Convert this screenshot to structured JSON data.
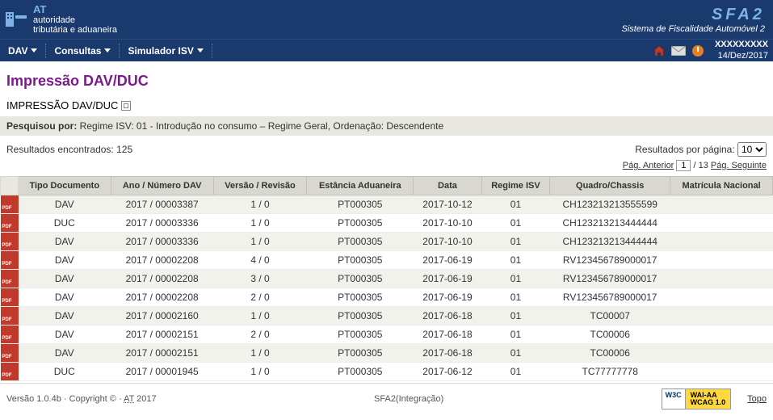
{
  "header": {
    "org_code": "AT",
    "org_line1": "autoridade",
    "org_line2": "tributária e aduaneira",
    "app_code": "SFA2",
    "app_name": "Sistema de Fiscalidade Automóvel 2"
  },
  "menu": {
    "items": [
      "DAV",
      "Consultas",
      "Simulador ISV"
    ],
    "user": "XXXXXXXXX",
    "date": "14/Dez/2017"
  },
  "page": {
    "title": "Impressão DAV/DUC",
    "section": "IMPRESSÃO DAV/DUC",
    "search_label": "Pesquisou por:",
    "search_text": " Regime ISV: 01 - Introdução no consumo – Regime Geral, Ordenação: Descendente",
    "results_count_label": "Resultados encontrados: ",
    "results_count": "125",
    "results_per_page_label": "Resultados por página: ",
    "results_per_page_value": "10",
    "pag_prev": "Pág. Anterior",
    "pag_current": "1",
    "pag_total": "/ 13 ",
    "pag_next": "Pág. Seguinte"
  },
  "columns": [
    "Tipo Documento",
    "Ano / Número DAV",
    "Versão / Revisão",
    "Estância Aduaneira",
    "Data",
    "Regime ISV",
    "Quadro/Chassis",
    "Matrícula Nacional"
  ],
  "rows": [
    {
      "tipo": "DAV",
      "ano": "2017 / 00003387",
      "ver": "1 / 0",
      "est": "PT000305",
      "data": "2017-10-12",
      "reg": "01",
      "chassis": "CH123213213555599",
      "mat": ""
    },
    {
      "tipo": "DUC",
      "ano": "2017 / 00003336",
      "ver": "1 / 0",
      "est": "PT000305",
      "data": "2017-10-10",
      "reg": "01",
      "chassis": "CH123213213444444",
      "mat": ""
    },
    {
      "tipo": "DAV",
      "ano": "2017 / 00003336",
      "ver": "1 / 0",
      "est": "PT000305",
      "data": "2017-10-10",
      "reg": "01",
      "chassis": "CH123213213444444",
      "mat": ""
    },
    {
      "tipo": "DAV",
      "ano": "2017 / 00002208",
      "ver": "4 / 0",
      "est": "PT000305",
      "data": "2017-06-19",
      "reg": "01",
      "chassis": "RV123456789000017",
      "mat": ""
    },
    {
      "tipo": "DAV",
      "ano": "2017 / 00002208",
      "ver": "3 / 0",
      "est": "PT000305",
      "data": "2017-06-19",
      "reg": "01",
      "chassis": "RV123456789000017",
      "mat": ""
    },
    {
      "tipo": "DAV",
      "ano": "2017 / 00002208",
      "ver": "2 / 0",
      "est": "PT000305",
      "data": "2017-06-19",
      "reg": "01",
      "chassis": "RV123456789000017",
      "mat": ""
    },
    {
      "tipo": "DAV",
      "ano": "2017 / 00002160",
      "ver": "1 / 0",
      "est": "PT000305",
      "data": "2017-06-18",
      "reg": "01",
      "chassis": "TC00007",
      "mat": ""
    },
    {
      "tipo": "DAV",
      "ano": "2017 / 00002151",
      "ver": "2 / 0",
      "est": "PT000305",
      "data": "2017-06-18",
      "reg": "01",
      "chassis": "TC00006",
      "mat": ""
    },
    {
      "tipo": "DAV",
      "ano": "2017 / 00002151",
      "ver": "1 / 0",
      "est": "PT000305",
      "data": "2017-06-18",
      "reg": "01",
      "chassis": "TC00006",
      "mat": ""
    },
    {
      "tipo": "DUC",
      "ano": "2017 / 00001945",
      "ver": "1 / 0",
      "est": "PT000305",
      "data": "2017-06-12",
      "reg": "01",
      "chassis": "TC77777778",
      "mat": ""
    }
  ],
  "footer": {
    "version": "Versão 1.0.4b · Copyright © · ",
    "at": "AT",
    "year": " 2017",
    "center": "SFA2(Integração)",
    "w3c": "W3C",
    "wai1": "WAI-AA",
    "wai2": "WCAG 1.0",
    "topo": "Topo"
  }
}
